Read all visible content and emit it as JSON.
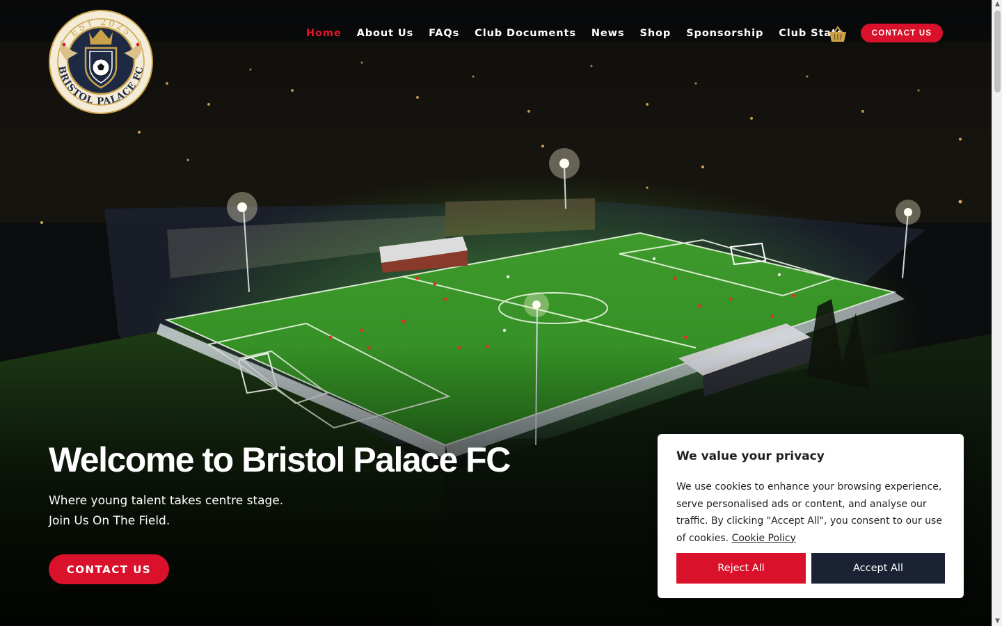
{
  "logo": {
    "top_text": "EST 2025",
    "bottom_text": "BRISTOL PALACE FC"
  },
  "nav": {
    "items": [
      {
        "label": "Home",
        "active": true
      },
      {
        "label": "About Us",
        "active": false
      },
      {
        "label": "FAQs",
        "active": false
      },
      {
        "label": "Club Documents",
        "active": false
      },
      {
        "label": "News",
        "active": false
      },
      {
        "label": "Shop",
        "active": false
      },
      {
        "label": "Sponsorship",
        "active": false
      },
      {
        "label": "Club Stats",
        "active": false
      }
    ],
    "basket_icon": "basket-icon",
    "cta_label": "CONTACT US"
  },
  "hero": {
    "title": "Welcome to Bristol Palace FC",
    "subtitle_line1": "Where young talent takes centre stage.",
    "subtitle_line2": "Join Us On The Field.",
    "cta_label": "CONTACT US",
    "background": "floodlit-football-pitch-aerial-night"
  },
  "cookie_banner": {
    "title": "We value your privacy",
    "text": "We use cookies to enhance your browsing experience, serve personalised ads or content, and analyse our traffic. By clicking \"Accept All\", you consent to our use of cookies.",
    "link_label": "Cookie Policy",
    "reject_label": "Reject All",
    "accept_label": "Accept All"
  },
  "colors": {
    "accent_red": "#d9112a",
    "navy": "#1a2233",
    "gold": "#c9a24a",
    "pitch_green": "#3fa02a"
  }
}
